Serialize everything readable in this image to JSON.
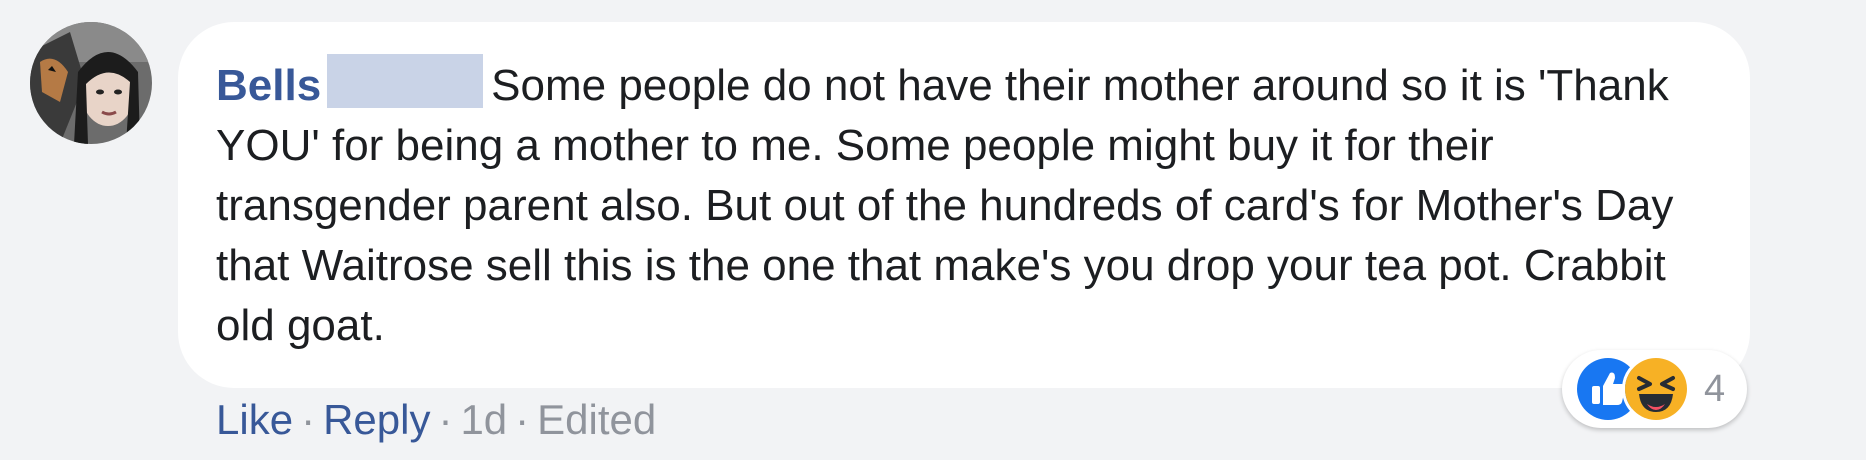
{
  "comment": {
    "author": "Bells",
    "author_surname_redacted": true,
    "text": "Some people do not have their mother around so it is 'Thank YOU' for being a mother to me. Some people might buy it for their transgender parent also. But out of the hundreds of card's for Mother's Day that Waitrose sell this is the one that make's you drop your tea pot. Crabbit old goat.",
    "avatar_icon": "user-avatar-photo"
  },
  "reactions": {
    "icons": [
      "like-icon",
      "haha-icon"
    ],
    "count": "4",
    "colors": {
      "like": "#1877f2",
      "haha": "#f7b125"
    }
  },
  "actions": {
    "like_label": "Like",
    "reply_label": "Reply",
    "separator": "·",
    "timestamp": "1d",
    "edited_label": "Edited"
  },
  "colors": {
    "background": "#f2f3f5",
    "bubble": "#ffffff",
    "link": "#385898",
    "text": "#1c1e21",
    "meta": "#90949c",
    "redaction": "#c9d3e7"
  }
}
